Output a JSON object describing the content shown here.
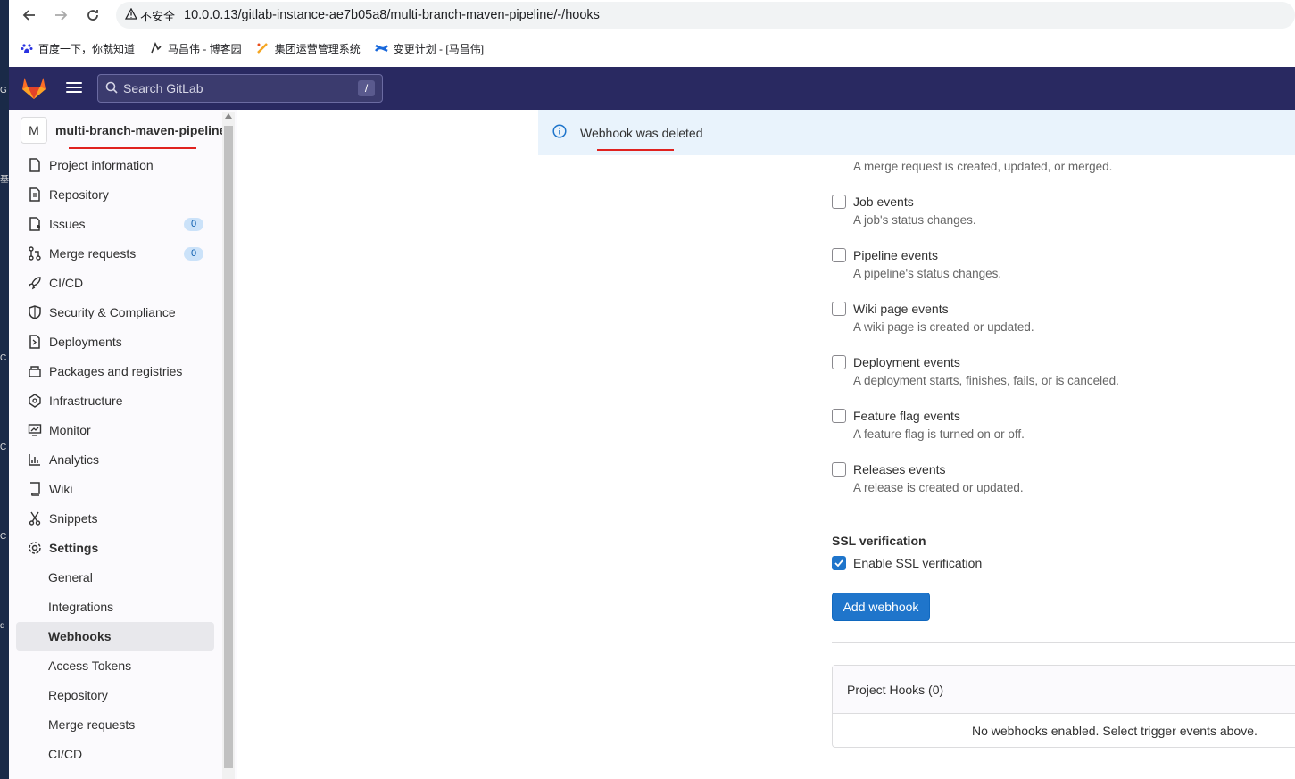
{
  "browser": {
    "security_label": "不安全",
    "url": "10.0.0.13/gitlab-instance-ae7b05a8/multi-branch-maven-pipeline/-/hooks",
    "bookmarks": [
      {
        "label": "百度一下，你就知道",
        "icon": "baidu-icon",
        "color": "#2932e1"
      },
      {
        "label": "马昌伟 - 博客园",
        "icon": "cnblogs-icon",
        "color": "#333333"
      },
      {
        "label": "集团运营管理系统",
        "icon": "group-system-icon",
        "color": "#f5a623"
      },
      {
        "label": "变更计划 - [马昌伟]",
        "icon": "confluence-icon",
        "color": "#1868db"
      }
    ]
  },
  "header": {
    "search_placeholder": "Search GitLab",
    "search_shortcut": "/",
    "brand_color": "#292961"
  },
  "sidebar": {
    "project_avatar": "M",
    "project_name": "multi-branch-maven-pipeline",
    "items": [
      {
        "label": "Project information",
        "icon": "project-info-icon"
      },
      {
        "label": "Repository",
        "icon": "repository-icon"
      },
      {
        "label": "Issues",
        "icon": "issues-icon",
        "badge": "0"
      },
      {
        "label": "Merge requests",
        "icon": "merge-request-icon",
        "badge": "0"
      },
      {
        "label": "CI/CD",
        "icon": "rocket-icon"
      },
      {
        "label": "Security & Compliance",
        "icon": "shield-icon"
      },
      {
        "label": "Deployments",
        "icon": "deployments-icon"
      },
      {
        "label": "Packages and registries",
        "icon": "package-icon"
      },
      {
        "label": "Infrastructure",
        "icon": "infrastructure-icon"
      },
      {
        "label": "Monitor",
        "icon": "monitor-icon"
      },
      {
        "label": "Analytics",
        "icon": "analytics-icon"
      },
      {
        "label": "Wiki",
        "icon": "book-icon"
      },
      {
        "label": "Snippets",
        "icon": "snippet-icon"
      },
      {
        "label": "Settings",
        "icon": "gear-icon"
      }
    ],
    "settings_sub": [
      {
        "label": "General"
      },
      {
        "label": "Integrations"
      },
      {
        "label": "Webhooks",
        "active": true
      },
      {
        "label": "Access Tokens"
      },
      {
        "label": "Repository"
      },
      {
        "label": "Merge requests"
      },
      {
        "label": "CI/CD"
      }
    ]
  },
  "flash": {
    "message": "Webhook was deleted"
  },
  "main": {
    "partial_desc": "A merge request is created, updated, or merged.",
    "triggers": [
      {
        "label": "Job events",
        "desc": "A job's status changes.",
        "checked": false
      },
      {
        "label": "Pipeline events",
        "desc": "A pipeline's status changes.",
        "checked": false
      },
      {
        "label": "Wiki page events",
        "desc": "A wiki page is created or updated.",
        "checked": false
      },
      {
        "label": "Deployment events",
        "desc": "A deployment starts, finishes, fails, or is canceled.",
        "checked": false
      },
      {
        "label": "Feature flag events",
        "desc": "A feature flag is turned on or off.",
        "checked": false
      },
      {
        "label": "Releases events",
        "desc": "A release is created or updated.",
        "checked": false
      }
    ],
    "ssl_heading": "SSL verification",
    "ssl_label": "Enable SSL verification",
    "ssl_checked": true,
    "add_button": "Add webhook",
    "hooks_title": "Project Hooks (0)",
    "hooks_empty": "No webhooks enabled. Select trigger events above."
  },
  "colors": {
    "accent": "#1f75cb",
    "flash_bg": "#e9f3fc",
    "annotation_red": "#e0221f"
  }
}
